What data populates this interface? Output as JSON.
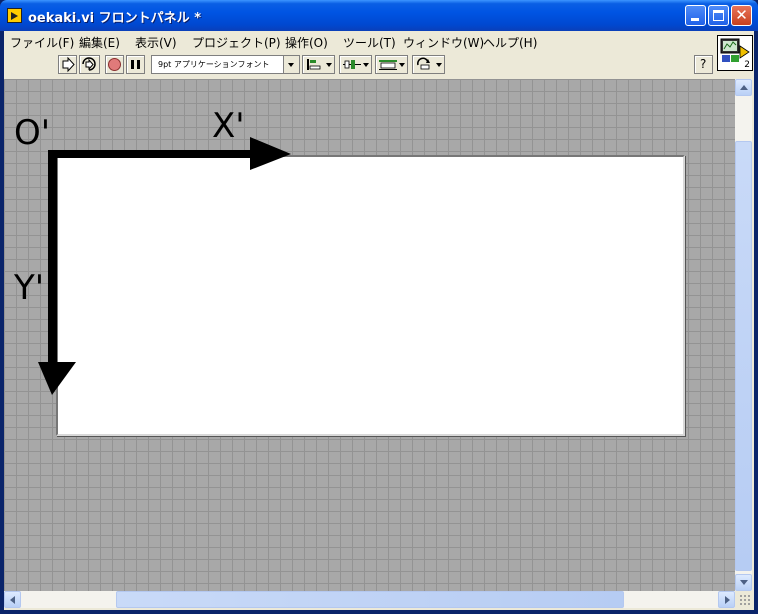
{
  "window": {
    "title": "oekaki.vi フロントパネル *",
    "controls": {
      "minimize": "minimize-icon",
      "maximize": "maximize-icon",
      "close": "✕"
    }
  },
  "menu": [
    "ファイル(F)",
    "編集(E)",
    "表示(V)",
    "プロジェクト(P)",
    "操作(O)",
    "ツール(T)",
    "ウィンドウ(W)",
    "ヘルプ(H)"
  ],
  "toolbar": {
    "run": "run-arrow-icon",
    "run_continuous": "run-continuously-icon",
    "abort": "abort-icon",
    "pause": "pause-icon",
    "font": "9pt アプリケーションフォント",
    "align": "align-objects-icon",
    "distribute": "distribute-objects-icon",
    "resize": "resize-objects-icon",
    "reorder": "reorder-icon",
    "help": "?"
  },
  "vi_icon": {
    "connector_count": "2"
  },
  "annotations": {
    "origin": "O'",
    "x_axis": "X'",
    "y_axis": "Y'"
  },
  "colors": {
    "title_bar": "#0054e3",
    "grid_bg": "#a8a8a8",
    "grid_line": "#939393",
    "picture_bg": "#ffffff",
    "arrow": "#000000"
  }
}
